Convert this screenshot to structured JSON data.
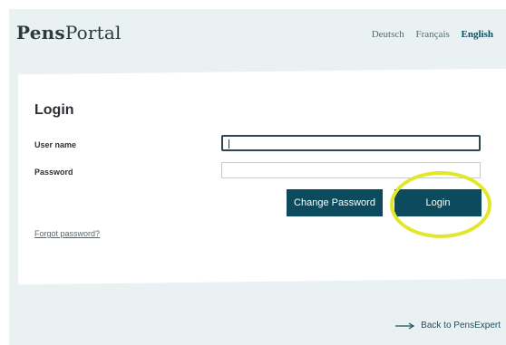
{
  "header": {
    "logo_bold": "Pens",
    "logo_regular": "Portal",
    "languages": [
      "Deutsch",
      "Français",
      "English"
    ],
    "active_language": "English"
  },
  "login": {
    "title": "Login",
    "username_label": "User name",
    "username_value": "",
    "password_label": "Password",
    "password_value": "",
    "change_password_label": "Change Password",
    "login_label": "Login",
    "forgot_password": "Forgot password?"
  },
  "footer": {
    "back_label": "Back to PensExpert",
    "arrow_icon": "arrow-right-icon"
  },
  "colors": {
    "background": "#e9f1f3",
    "button": "#0c4a5e",
    "highlight": "#e3e72a"
  }
}
